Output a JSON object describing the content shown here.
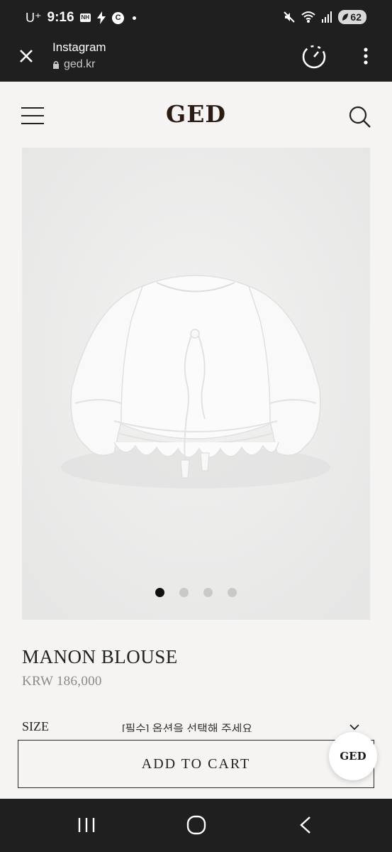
{
  "status_bar": {
    "carrier": "U⁺",
    "time": "9:16",
    "indicator_badge": "NH",
    "indicator_circle": "C",
    "battery": "62"
  },
  "browser": {
    "title": "Instagram",
    "url": "ged.kr"
  },
  "site": {
    "logo": "GED"
  },
  "carousel": {
    "dots": 4,
    "active_index": 0
  },
  "product": {
    "name": "MANON BLOUSE",
    "price": "KRW 186,000",
    "size_label": "SIZE",
    "size_value": "[필수] 옵션을 선택해 주세요"
  },
  "actions": {
    "add_to_cart": "ADD TO CART",
    "chat_label": "GED"
  }
}
